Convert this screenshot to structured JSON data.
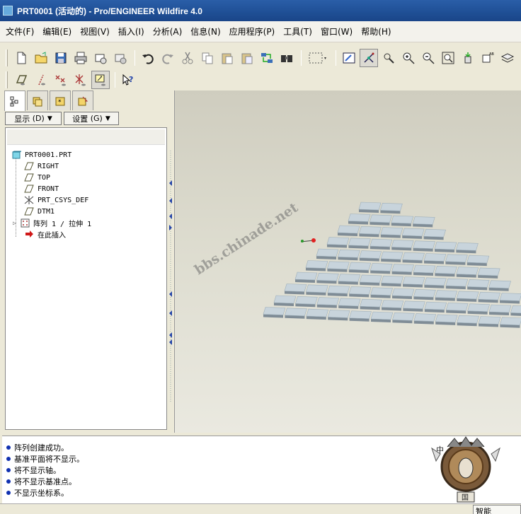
{
  "window": {
    "title": "PRT0001 (活动的) - Pro/ENGINEER Wildfire 4.0"
  },
  "menu": [
    "文件(F)",
    "编辑(E)",
    "视图(V)",
    "插入(I)",
    "分析(A)",
    "信息(N)",
    "应用程序(P)",
    "工具(T)",
    "窗口(W)",
    "帮助(H)"
  ],
  "toolbar1": {
    "icons": [
      "new-file-icon",
      "open-file-icon",
      "save-icon",
      "print-icon",
      "send-mail-icon",
      "mail-attach-icon",
      "undo-icon",
      "redo-icon",
      "cut-icon",
      "copy-icon",
      "paste-icon",
      "paste-special-icon",
      "regenerate-icon",
      "find-icon",
      "select-box-icon",
      "repaint-icon",
      "spin-center-icon",
      "orient-icon",
      "zoom-in-icon",
      "zoom-out-icon",
      "refit-icon",
      "reorient-icon",
      "saved-views-icon",
      "layers-icon"
    ]
  },
  "toolbar2": {
    "icons": [
      "datum-plane-display-icon",
      "datum-axis-display-icon",
      "datum-point-display-icon",
      "csys-display-icon",
      "spin-center-display-icon",
      "context-help-icon"
    ]
  },
  "navigator": {
    "tabs": [
      "model-tree-tab",
      "folder-browser-tab",
      "favorites-tab",
      "connections-tab"
    ],
    "display_label": "显示",
    "display_key": "(D)",
    "settings_label": "设置",
    "settings_key": "(G)"
  },
  "tree": {
    "items": [
      {
        "label": "PRT0001.PRT",
        "icon": "part-icon"
      },
      {
        "label": "RIGHT",
        "icon": "datum-plane-icon"
      },
      {
        "label": "TOP",
        "icon": "datum-plane-icon"
      },
      {
        "label": "FRONT",
        "icon": "datum-plane-icon"
      },
      {
        "label": "PRT_CSYS_DEF",
        "icon": "coordinate-system-icon"
      },
      {
        "label": "DTM1",
        "icon": "datum-plane-icon"
      },
      {
        "label": "阵列 1 / 拉伸 1",
        "icon": "pattern-icon"
      },
      {
        "label": "在此插入",
        "icon": "insert-here-arrow-icon"
      }
    ]
  },
  "viewport": {
    "watermark": "bbs.chinade.net"
  },
  "model": {
    "type": "brick-pattern",
    "rows": [
      2,
      4,
      5,
      7,
      8,
      9,
      10,
      12,
      14,
      14
    ],
    "color": "#c8d4dc",
    "side_color": "#7f8c96"
  },
  "messages": [
    "阵列创建成功。",
    "基准平面将不显示。",
    "将不显示轴。",
    "将不显示基准点。",
    "不显示坐标系。"
  ],
  "status": {
    "filter_value": "智能"
  },
  "emblem": {
    "top_char": "中",
    "bottom_char": "国"
  },
  "colors": {
    "title_bar": "#1f4f95",
    "message_bullet": "#1030b0",
    "selected_pattern_origin": "#e02020"
  }
}
